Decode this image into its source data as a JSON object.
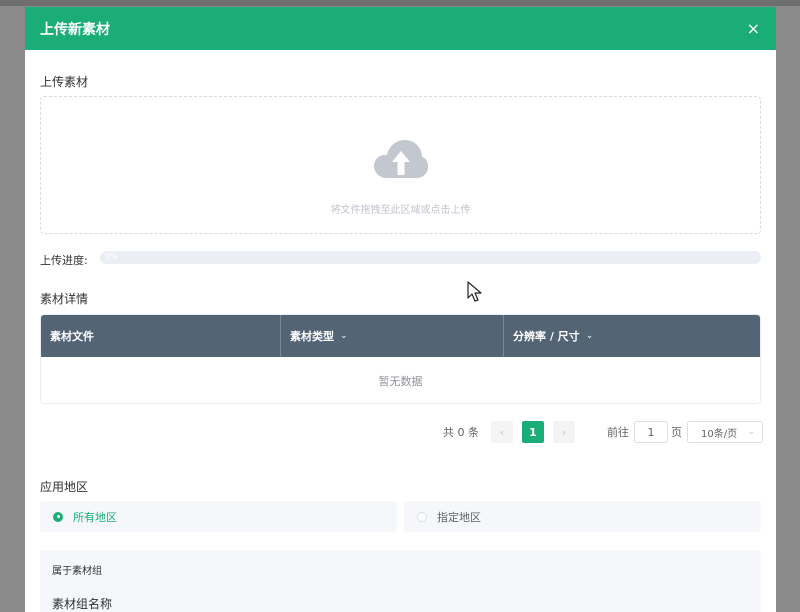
{
  "dialog": {
    "title": "上传新素材",
    "close_glyph": "×"
  },
  "upload": {
    "section_label": "上传素材",
    "drop_text": "将文件拖拽至此区域或点击上传",
    "icon": "cloud-upload-icon"
  },
  "progress": {
    "label": "上传进度:",
    "percent": 0,
    "percent_text": "0%"
  },
  "details": {
    "section_label": "素材详情",
    "columns": [
      {
        "label": "素材文件",
        "sortable": false
      },
      {
        "label": "素材类型",
        "sortable": true
      },
      {
        "label": "分辨率 / 尺寸",
        "sortable": true
      }
    ],
    "empty_text": "暂无数据"
  },
  "pagination": {
    "total_text": "共 0 条",
    "prev_glyph": "‹",
    "current_page": "1",
    "next_glyph": "›",
    "goto_label": "前往",
    "goto_value": "1",
    "page_suffix": "页",
    "page_size": "10条/页",
    "size_chevron": "⌄"
  },
  "region": {
    "section_label": "应用地区",
    "options": [
      {
        "label": "所有地区",
        "checked": true
      },
      {
        "label": "指定地区",
        "checked": false
      }
    ]
  },
  "group": {
    "label": "属于素材组",
    "name_label": "素材组名称"
  },
  "colors": {
    "accent": "#1aad77",
    "table_header": "#536475",
    "placeholder": "#c0c4cc",
    "text": "#303133"
  }
}
